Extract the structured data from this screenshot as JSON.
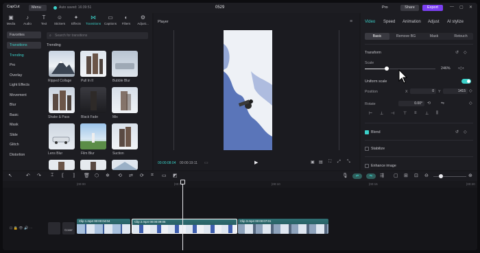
{
  "app": {
    "logo": "CapCut",
    "menu": "Menu",
    "saved_status": "Auto saved: 16:39:51",
    "title": "0529",
    "pro": "Pro",
    "share": "Share",
    "export": "Export",
    "window_controls": [
      "—",
      "▢",
      "✕"
    ]
  },
  "toolbar": {
    "tools": [
      {
        "label": "Media",
        "icon": "▣"
      },
      {
        "label": "Audio",
        "icon": "♪"
      },
      {
        "label": "Text",
        "icon": "T"
      },
      {
        "label": "Stickers",
        "icon": "☺"
      },
      {
        "label": "Effects",
        "icon": "✦"
      },
      {
        "label": "Transitions",
        "icon": "⋈"
      },
      {
        "label": "Captions",
        "icon": "▭"
      },
      {
        "label": "Filters",
        "icon": "◐"
      },
      {
        "label": "Adjust...",
        "icon": "⚙"
      }
    ]
  },
  "left_panel": {
    "categories": [
      "Favorites",
      "Transitions",
      "Trending",
      "Pro",
      "Overlay",
      "Light Effects",
      "Movement",
      "Blur",
      "Basic",
      "Mask",
      "Slide",
      "Glitch",
      "Distortion"
    ],
    "search_placeholder": "Search for transitions",
    "section": "Trending",
    "items": [
      {
        "label": "Ripped Collage"
      },
      {
        "label": "Pull In II"
      },
      {
        "label": "Bubble Blur"
      },
      {
        "label": "Shake & Pass"
      },
      {
        "label": "Black Fade"
      },
      {
        "label": "Mix"
      },
      {
        "label": "Lens Blur"
      },
      {
        "label": "Film Blur"
      },
      {
        "label": "Suction"
      }
    ]
  },
  "player": {
    "title": "Player",
    "current_time": "00:00:08:04",
    "total_time": "00:00:19:11"
  },
  "right_panel": {
    "tabs": [
      "Video",
      "Speed",
      "Animation",
      "Adjust",
      "AI stylize"
    ],
    "subtabs": [
      "Basic",
      "Remove BG",
      "Mask",
      "Retouch"
    ],
    "transform": "Transform",
    "scale_label": "Scale",
    "scale_value": "246%",
    "scale_fraction": 0.31,
    "uniform_scale": "Uniform scale",
    "position_label": "Position",
    "pos_x_label": "X",
    "pos_x": "0",
    "pos_y_label": "Y",
    "pos_y": "1415",
    "rotate_label": "Rotate",
    "rotate_value": "0.00°",
    "blend": "Blend",
    "stabilize": "Stabilize",
    "enhance": "Enhance image"
  },
  "timeline": {
    "ticks": [
      "|00:00",
      "|00:05",
      "|00:10",
      "|00:15",
      "|00:20",
      "|00:25"
    ],
    "cover_label": "Cover",
    "clips": [
      {
        "label": "Clip 1.mp4  00:00:04:04"
      },
      {
        "label": "Clip 2.mp4  00:00:09:06"
      },
      {
        "label": "Clip 3.mp4  00:00:07:01"
      }
    ]
  }
}
